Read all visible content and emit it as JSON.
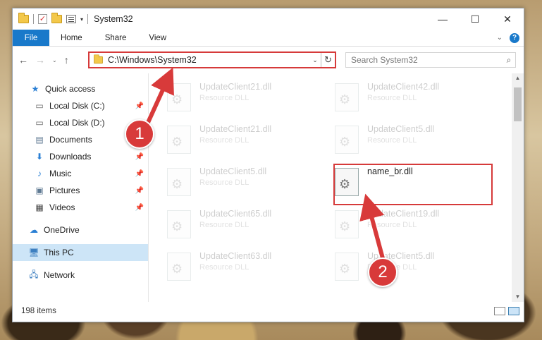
{
  "window": {
    "title": "System32"
  },
  "titlebar": {
    "minimize": "—",
    "maximize": "☐",
    "close": "✕"
  },
  "ribbon": {
    "tabs": [
      "File",
      "Home",
      "Share",
      "View"
    ]
  },
  "address": {
    "path": "C:\\Windows\\System32"
  },
  "search": {
    "placeholder": "Search System32"
  },
  "nav_pane": {
    "items": [
      {
        "label": "Quick access",
        "icon": "star-icon"
      },
      {
        "label": "Local Disk (C:)",
        "icon": "drive-icon",
        "pinned": true
      },
      {
        "label": "Local Disk (D:)",
        "icon": "drive-icon"
      },
      {
        "label": "Documents",
        "icon": "documents-icon",
        "pinned": true
      },
      {
        "label": "Downloads",
        "icon": "download-icon",
        "pinned": true
      },
      {
        "label": "Music",
        "icon": "music-icon",
        "pinned": true
      },
      {
        "label": "Pictures",
        "icon": "pictures-icon",
        "pinned": true
      },
      {
        "label": "Videos",
        "icon": "videos-icon",
        "pinned": true
      },
      {
        "label": "OneDrive",
        "icon": "cloud-icon"
      },
      {
        "label": "This PC",
        "icon": "computer-icon",
        "selected": true
      },
      {
        "label": "Network",
        "icon": "network-icon"
      }
    ]
  },
  "files": [
    {
      "name": "UpdateClient21.dll",
      "type": "Resource DLL"
    },
    {
      "name": "UpdateClient42.dll",
      "type": "Resource DLL"
    },
    {
      "name": "UpdateClient21.dll",
      "type": "Resource DLL"
    },
    {
      "name": "UpdateClient5.dll",
      "type": "Resource DLL"
    },
    {
      "name": "UpdateClient5.dll",
      "type": "Resource DLL"
    },
    {
      "name": "name_br.dll",
      "type": ""
    },
    {
      "name": "UpdateClient65.dll",
      "type": "Resource DLL"
    },
    {
      "name": "UpdateClient19.dll",
      "type": "Resource DLL"
    },
    {
      "name": "UpdateClient63.dll",
      "type": "Resource DLL"
    },
    {
      "name": "UpdateClient5.dll",
      "type": "Resource DLL"
    }
  ],
  "status": {
    "item_count": "198 items"
  },
  "annotations": {
    "step1": "1",
    "step2": "2",
    "color": "#d83a3a"
  }
}
